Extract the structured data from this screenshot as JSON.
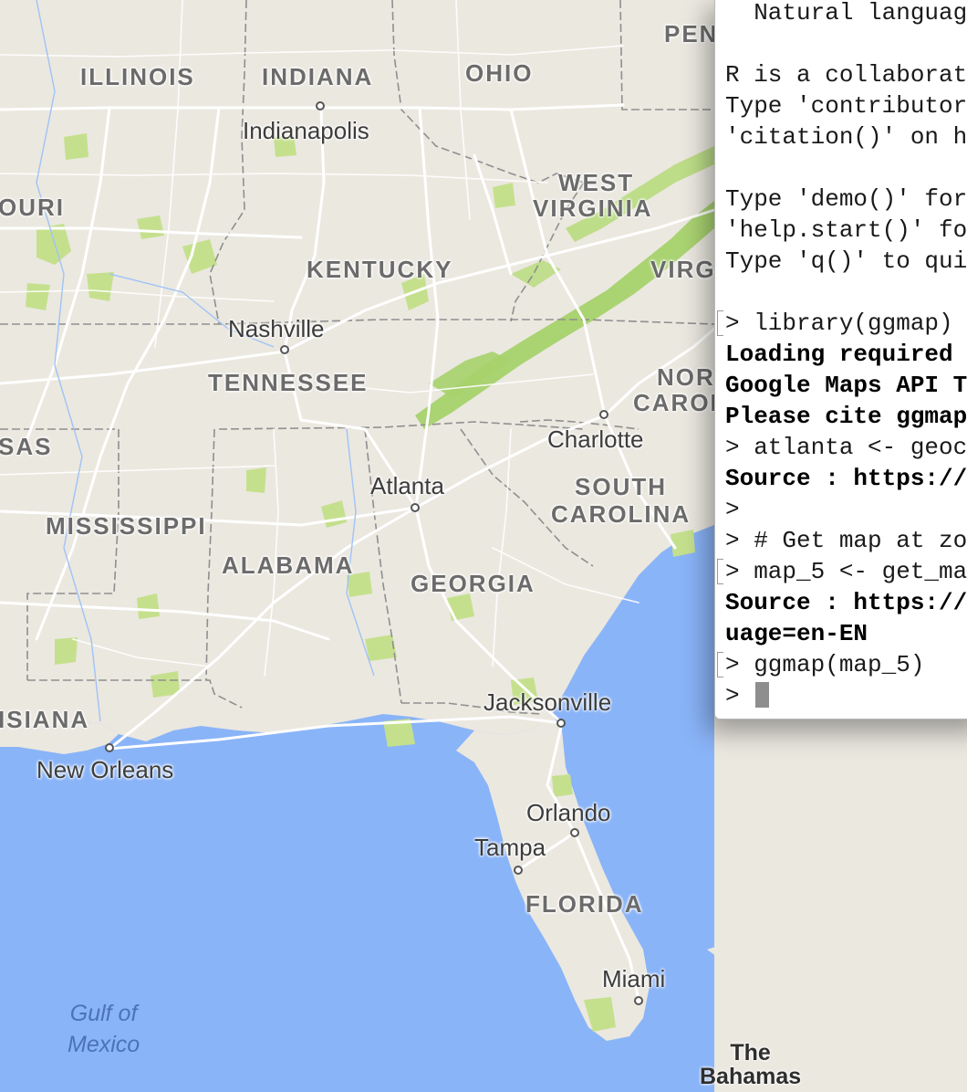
{
  "map": {
    "states": {
      "illinois": "ILLINOIS",
      "indiana": "INDIANA",
      "ohio": "OHIO",
      "pennsylvania": "PEN",
      "missouri": "OURI",
      "west_virginia_1": "WEST",
      "west_virginia_2": "VIRGINIA",
      "kentucky": "KENTUCKY",
      "virginia": "VIRG",
      "tennessee": "TENNESSEE",
      "north_carolina_1": "NOR",
      "north_carolina_2": "CAROL",
      "arkansas": "SAS",
      "south_carolina_1": "SOUTH",
      "south_carolina_2": "CAROLINA",
      "mississippi": "MISSISSIPPI",
      "alabama": "ALABAMA",
      "georgia": "GEORGIA",
      "louisiana": "ISIANA",
      "florida": "FLORIDA"
    },
    "cities": {
      "indianapolis": "Indianapolis",
      "nashville": "Nashville",
      "charlotte": "Charlotte",
      "atlanta": "Atlanta",
      "jacksonville": "Jacksonville",
      "new_orleans": "New Orleans",
      "orlando": "Orlando",
      "tampa": "Tampa",
      "miami": "Miami"
    },
    "water": {
      "gulf_1": "Gulf of",
      "gulf_2": "Mexico"
    },
    "islands": {
      "bahamas_1": "The",
      "bahamas_2": "Bahamas"
    },
    "colors": {
      "land": "#ebe8e0",
      "water": "#8ab4f8",
      "parks": "#c5e08d",
      "mountains": "#a6d26b",
      "roads": "#ffffff",
      "borders": "#8f8f8f"
    }
  },
  "console": {
    "lines": [
      "  Natural languag",
      "",
      "R is a collaborat",
      "Type 'contributor",
      "'citation()' on h",
      "",
      "Type 'demo()' for",
      "'help.start()' fo",
      "Type 'q()' to qui",
      "",
      "> library(ggmap)",
      "Loading required ",
      "Google Maps API T",
      "Please cite ggmap",
      "> atlanta <- geoc",
      "Source : https://",
      ">",
      "> # Get map at zo",
      "> map_5 <- get_ma",
      "Source : https://",
      "uage=en-EN",
      "> ggmap(map_5)",
      "> "
    ],
    "cursor_color": "#8e8e8e"
  }
}
